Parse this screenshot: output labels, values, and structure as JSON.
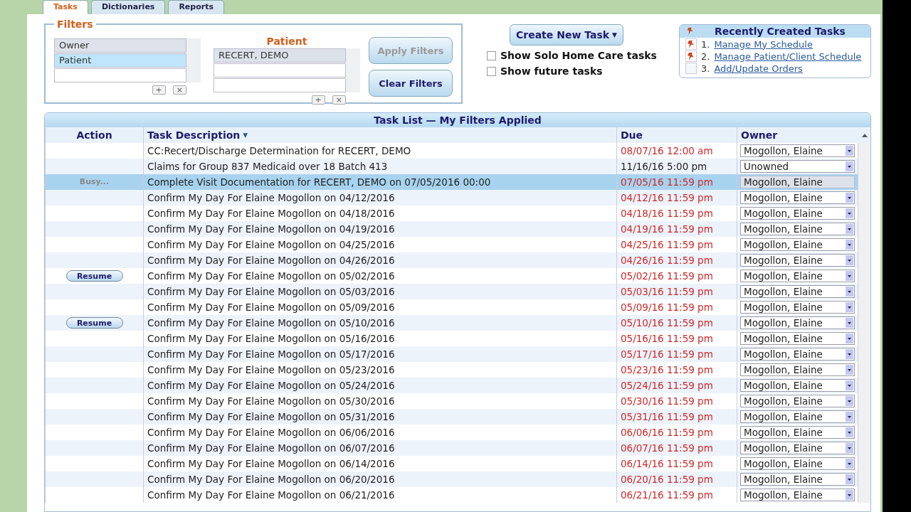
{
  "tabs": [
    {
      "label": "Tasks",
      "selected": true
    },
    {
      "label": "Dictionaries",
      "selected": false
    },
    {
      "label": "Reports",
      "selected": false
    }
  ],
  "filters": {
    "title": "Filters",
    "fields": [
      {
        "label": "Owner",
        "selected": false
      },
      {
        "label": "Patient",
        "selected": true
      }
    ],
    "value_title": "Patient",
    "values": [
      {
        "label": "RECERT, DEMO",
        "selected": false
      }
    ],
    "add": "+",
    "remove": "×",
    "buttons": [
      {
        "label": "Apply Filters",
        "disabled": true
      },
      {
        "label": "Clear Filters",
        "disabled": false
      }
    ]
  },
  "create_button": {
    "label": "Create New Task",
    "caret": "▼"
  },
  "options": [
    {
      "label": "Show Solo Home Care tasks",
      "checked": false
    },
    {
      "label": "Show future tasks",
      "checked": false
    }
  ],
  "recent": {
    "title": "Recently Created Tasks",
    "items": [
      {
        "number": "1.",
        "label": "Manage My Schedule",
        "pinned": true
      },
      {
        "number": "2.",
        "label": "Manage Patient/Client Schedule",
        "pinned": true
      },
      {
        "number": "3.",
        "label": "Add/Update Orders",
        "pinned": false
      }
    ]
  },
  "task_list": {
    "title": "Task List — My Filters Applied",
    "columns": [
      "Action",
      "Task Description",
      "Due",
      "Owner"
    ],
    "sort_caret": "▼",
    "rows": [
      {
        "action": "",
        "kind": "none",
        "description": "CC:Recert/Discharge Determination for RECERT, DEMO",
        "due": "08/07/16 12:00 am",
        "overdue": true,
        "owner": "Mogollon, Elaine",
        "selected": false
      },
      {
        "action": "",
        "kind": "none",
        "description": "Claims for Group 837 Medicaid over 18 Batch 413",
        "due": "11/16/16 5:00 pm",
        "overdue": false,
        "owner": "Unowned",
        "selected": false
      },
      {
        "action": "Busy...",
        "kind": "busy",
        "description": "Complete Visit Documentation for RECERT, DEMO on 07/05/2016 00:00",
        "due": "07/05/16 11:59 pm",
        "overdue": true,
        "owner": "Mogollon, Elaine",
        "selected": true
      },
      {
        "action": "",
        "kind": "none",
        "description": "Confirm My Day For Elaine Mogollon on 04/12/2016",
        "due": "04/12/16 11:59 pm",
        "overdue": true,
        "owner": "Mogollon, Elaine",
        "selected": false
      },
      {
        "action": "",
        "kind": "none",
        "description": "Confirm My Day For Elaine Mogollon on 04/18/2016",
        "due": "04/18/16 11:59 pm",
        "overdue": true,
        "owner": "Mogollon, Elaine",
        "selected": false
      },
      {
        "action": "",
        "kind": "none",
        "description": "Confirm My Day For Elaine Mogollon on 04/19/2016",
        "due": "04/19/16 11:59 pm",
        "overdue": true,
        "owner": "Mogollon, Elaine",
        "selected": false
      },
      {
        "action": "",
        "kind": "none",
        "description": "Confirm My Day For Elaine Mogollon on 04/25/2016",
        "due": "04/25/16 11:59 pm",
        "overdue": true,
        "owner": "Mogollon, Elaine",
        "selected": false
      },
      {
        "action": "",
        "kind": "none",
        "description": "Confirm My Day For Elaine Mogollon on 04/26/2016",
        "due": "04/26/16 11:59 pm",
        "overdue": true,
        "owner": "Mogollon, Elaine",
        "selected": false
      },
      {
        "action": "Resume",
        "kind": "resume",
        "description": "Confirm My Day For Elaine Mogollon on 05/02/2016",
        "due": "05/02/16 11:59 pm",
        "overdue": true,
        "owner": "Mogollon, Elaine",
        "selected": false
      },
      {
        "action": "",
        "kind": "none",
        "description": "Confirm My Day For Elaine Mogollon on 05/03/2016",
        "due": "05/03/16 11:59 pm",
        "overdue": true,
        "owner": "Mogollon, Elaine",
        "selected": false
      },
      {
        "action": "",
        "kind": "none",
        "description": "Confirm My Day For Elaine Mogollon on 05/09/2016",
        "due": "05/09/16 11:59 pm",
        "overdue": true,
        "owner": "Mogollon, Elaine",
        "selected": false
      },
      {
        "action": "Resume",
        "kind": "resume",
        "description": "Confirm My Day For Elaine Mogollon on 05/10/2016",
        "due": "05/10/16 11:59 pm",
        "overdue": true,
        "owner": "Mogollon, Elaine",
        "selected": false
      },
      {
        "action": "",
        "kind": "none",
        "description": "Confirm My Day For Elaine Mogollon on 05/16/2016",
        "due": "05/16/16 11:59 pm",
        "overdue": true,
        "owner": "Mogollon, Elaine",
        "selected": false
      },
      {
        "action": "",
        "kind": "none",
        "description": "Confirm My Day For Elaine Mogollon on 05/17/2016",
        "due": "05/17/16 11:59 pm",
        "overdue": true,
        "owner": "Mogollon, Elaine",
        "selected": false
      },
      {
        "action": "",
        "kind": "none",
        "description": "Confirm My Day For Elaine Mogollon on 05/23/2016",
        "due": "05/23/16 11:59 pm",
        "overdue": true,
        "owner": "Mogollon, Elaine",
        "selected": false
      },
      {
        "action": "",
        "kind": "none",
        "description": "Confirm My Day For Elaine Mogollon on 05/24/2016",
        "due": "05/24/16 11:59 pm",
        "overdue": true,
        "owner": "Mogollon, Elaine",
        "selected": false
      },
      {
        "action": "",
        "kind": "none",
        "description": "Confirm My Day For Elaine Mogollon on 05/30/2016",
        "due": "05/30/16 11:59 pm",
        "overdue": true,
        "owner": "Mogollon, Elaine",
        "selected": false
      },
      {
        "action": "",
        "kind": "none",
        "description": "Confirm My Day For Elaine Mogollon on 05/31/2016",
        "due": "05/31/16 11:59 pm",
        "overdue": true,
        "owner": "Mogollon, Elaine",
        "selected": false
      },
      {
        "action": "",
        "kind": "none",
        "description": "Confirm My Day For Elaine Mogollon on 06/06/2016",
        "due": "06/06/16 11:59 pm",
        "overdue": true,
        "owner": "Mogollon, Elaine",
        "selected": false
      },
      {
        "action": "",
        "kind": "none",
        "description": "Confirm My Day For Elaine Mogollon on 06/07/2016",
        "due": "06/07/16 11:59 pm",
        "overdue": true,
        "owner": "Mogollon, Elaine",
        "selected": false
      },
      {
        "action": "",
        "kind": "none",
        "description": "Confirm My Day For Elaine Mogollon on 06/14/2016",
        "due": "06/14/16 11:59 pm",
        "overdue": true,
        "owner": "Mogollon, Elaine",
        "selected": false
      },
      {
        "action": "",
        "kind": "none",
        "description": "Confirm My Day For Elaine Mogollon on 06/20/2016",
        "due": "06/20/16 11:59 pm",
        "overdue": true,
        "owner": "Mogollon, Elaine",
        "selected": false
      },
      {
        "action": "",
        "kind": "none",
        "description": "Confirm My Day For Elaine Mogollon on 06/21/2016",
        "due": "06/21/16 11:59 pm",
        "overdue": true,
        "owner": "Mogollon, Elaine",
        "selected": false
      }
    ]
  }
}
